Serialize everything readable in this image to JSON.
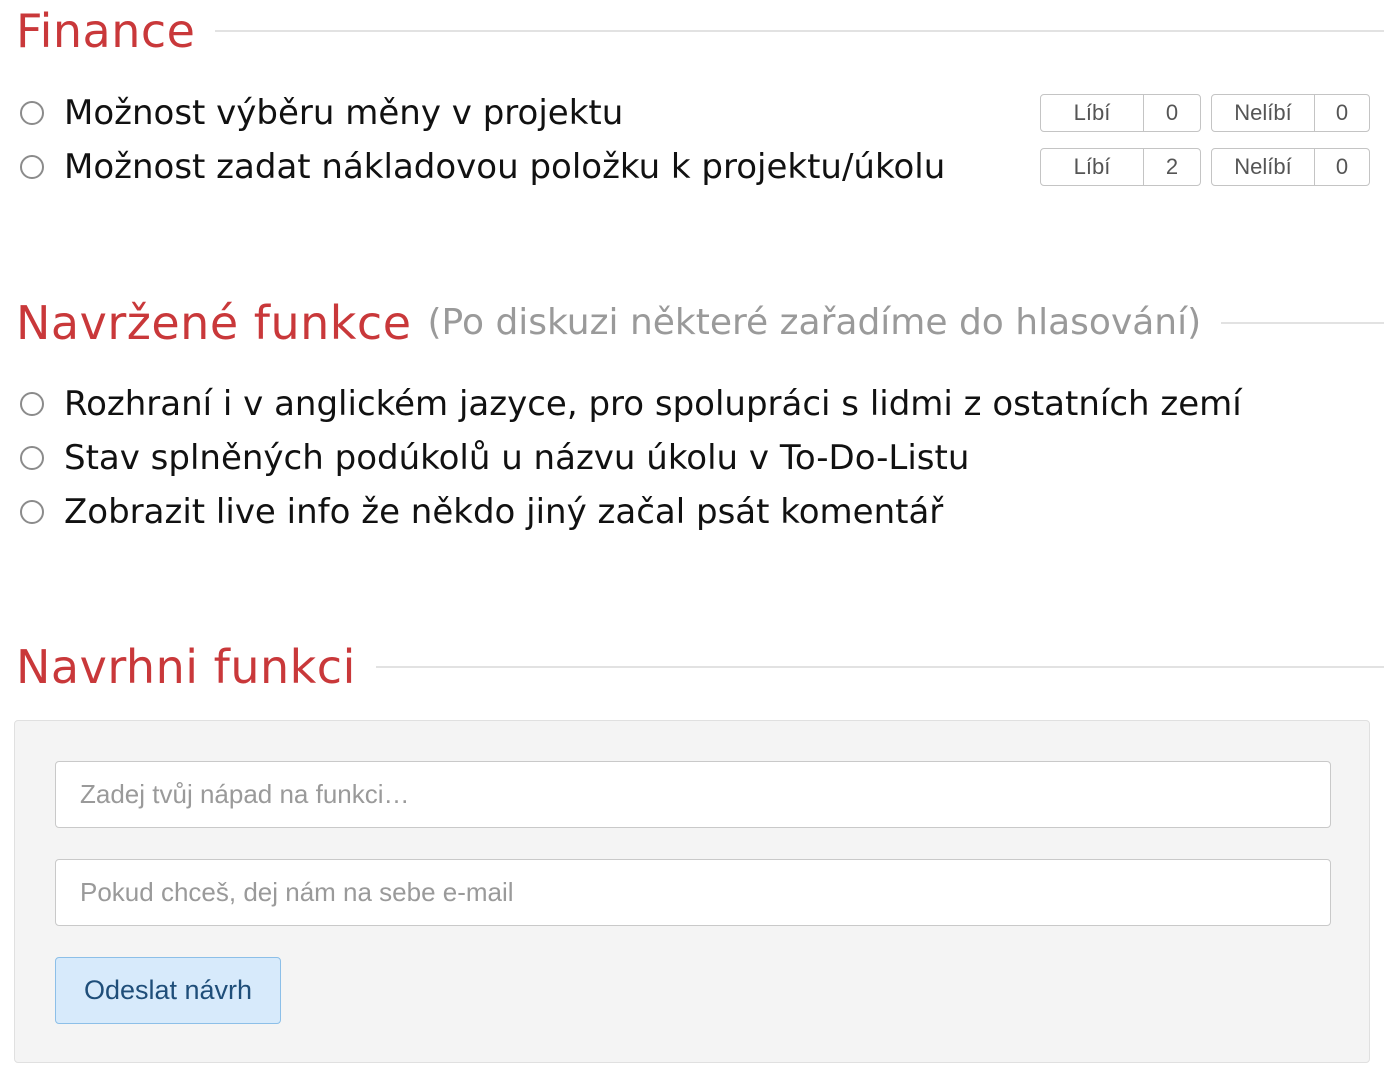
{
  "finance": {
    "title": "Finance",
    "items": [
      {
        "label": "Možnost výběru měny v projektu",
        "like_label": "Líbí",
        "like_count": "0",
        "dislike_label": "Nelíbí",
        "dislike_count": "0"
      },
      {
        "label": "Možnost zadat nákladovou položku k projektu/úkolu",
        "like_label": "Líbí",
        "like_count": "2",
        "dislike_label": "Nelíbí",
        "dislike_count": "0"
      }
    ]
  },
  "proposed": {
    "title": "Navržené funkce",
    "subtitle": "(Po diskuzi některé zařadíme do hlasování)",
    "items": [
      {
        "label": "Rozhraní i v anglickém jazyce, pro spolupráci s lidmi z ostatních zemí"
      },
      {
        "label": "Stav splněných podúkolů u názvu úkolu v To-Do-Listu"
      },
      {
        "label": "Zobrazit live info že někdo jiný začal psát komentář"
      }
    ]
  },
  "suggest": {
    "title": "Navrhni funkci",
    "idea_placeholder": "Zadej tvůj nápad na funkci…",
    "email_placeholder": "Pokud chceš, dej nám na sebe e-mail",
    "submit_label": "Odeslat návrh"
  },
  "colors": {
    "heading": "#c9383a",
    "subtitle": "#9a9a9a",
    "submit_bg": "#d7eafb",
    "submit_border": "#8cbfe8",
    "panel_bg": "#f4f4f4"
  }
}
